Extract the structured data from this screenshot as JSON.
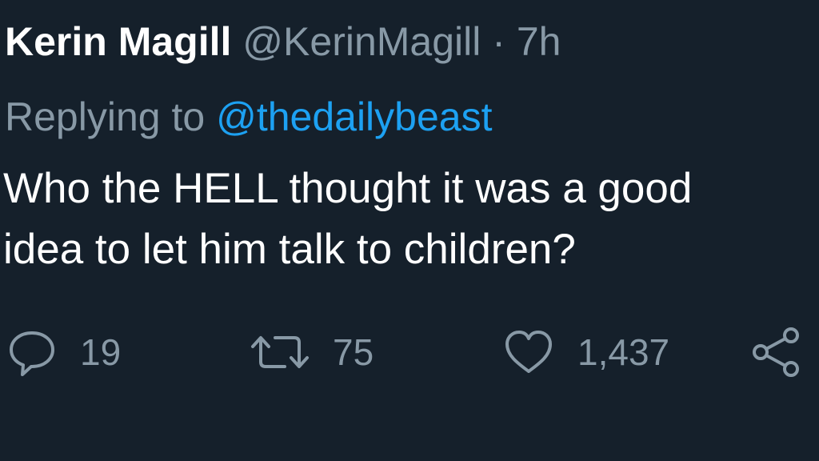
{
  "tweet": {
    "display_name": "Kerin Magill",
    "handle": "@KerinMagill",
    "separator": "·",
    "time": "7h",
    "replying_prefix": "Replying to",
    "replying_to": "@thedailybeast",
    "text_line1": "Who the HELL thought it was a good",
    "text_line2": "idea to let him talk to children?"
  },
  "actions": {
    "reply_icon": "reply-icon",
    "reply_count": "19",
    "retweet_icon": "retweet-icon",
    "retweet_count": "75",
    "like_icon": "heart-icon",
    "like_count": "1,437",
    "share_icon": "share-icon"
  },
  "colors": {
    "background": "#15202b",
    "text_primary": "#ffffff",
    "text_secondary": "#8899a6",
    "link": "#1da1f2"
  }
}
